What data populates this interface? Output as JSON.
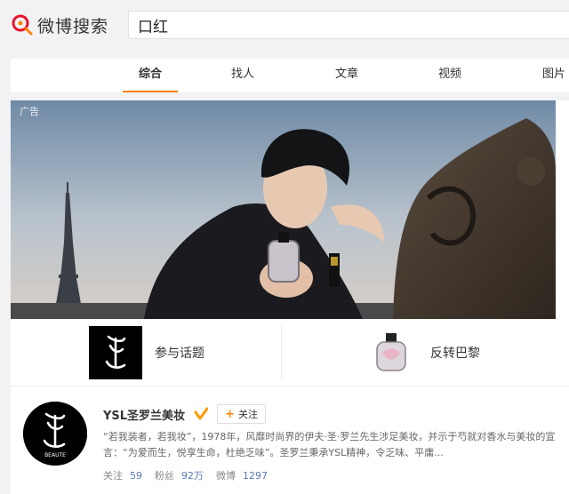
{
  "header": {
    "logo_text": "微博搜索",
    "search": {
      "value": "口红"
    }
  },
  "tabs": [
    {
      "label": "综合",
      "active": true
    },
    {
      "label": "找人"
    },
    {
      "label": "文章"
    },
    {
      "label": "视频"
    },
    {
      "label": "图片"
    }
  ],
  "banner": {
    "ad_label": "广告"
  },
  "sub_items": [
    {
      "label": "参与话题"
    },
    {
      "label": "反转巴黎"
    }
  ],
  "profile": {
    "name": "YSL圣罗兰美妆",
    "follow_label": "关注",
    "description": "“若我装者，若我妆”，1978年，风靡时尚界的伊夫·圣·罗兰先生涉足美妆，并示于芍就对香水与美妆的宣言：“为爱而生，悦享生命，杜绝乏味”。圣罗兰秉承YSL精神，令乏味、平庸...",
    "stats": [
      {
        "label": "关注",
        "value": "59"
      },
      {
        "label": "粉丝",
        "value": "92万"
      },
      {
        "label": "微博",
        "value": "1297"
      }
    ],
    "avatar_caption": "BEAUTE"
  },
  "colors": {
    "accent": "#ff8200",
    "link": "#5877b6",
    "logo_red": "#e6162d"
  }
}
